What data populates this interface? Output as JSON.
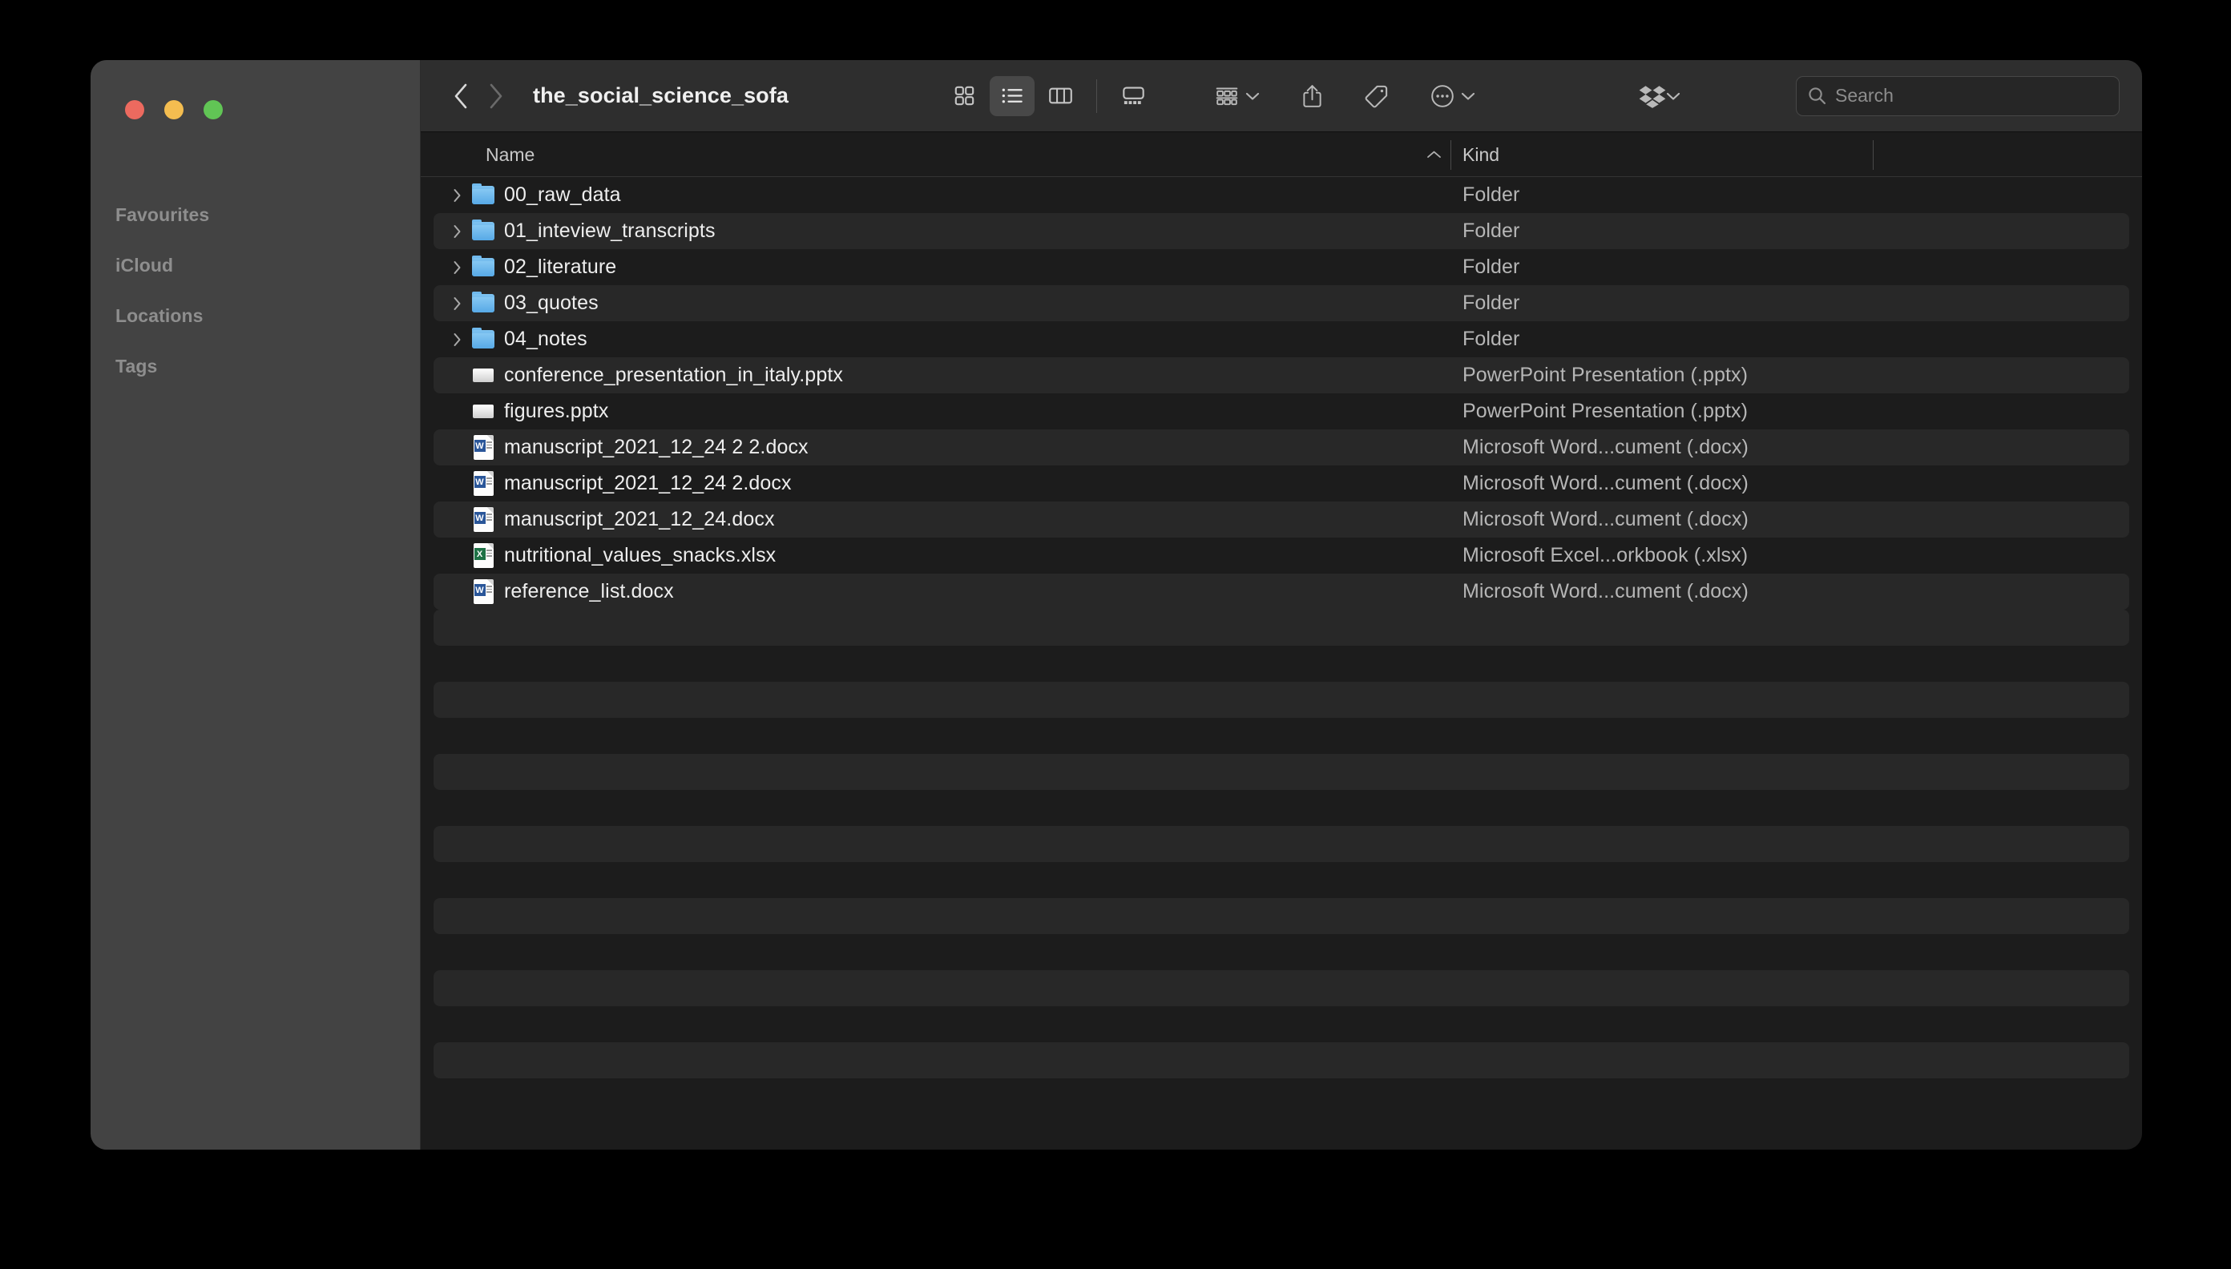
{
  "window": {
    "traffic_lights": [
      {
        "name": "close",
        "color": "#ec6a5f"
      },
      {
        "name": "minimize",
        "color": "#f4bd50"
      },
      {
        "name": "maximize",
        "color": "#61c555"
      }
    ]
  },
  "sidebar": {
    "sections": [
      {
        "label": "Favourites"
      },
      {
        "label": "iCloud"
      },
      {
        "label": "Locations"
      },
      {
        "label": "Tags"
      }
    ]
  },
  "toolbar": {
    "back_icon": "chevron-left-icon",
    "forward_icon": "chevron-right-icon",
    "title": "the_social_science_sofa",
    "view_modes": [
      {
        "name": "icon-view",
        "icon": "grid-icon",
        "active": false
      },
      {
        "name": "list-view",
        "icon": "list-icon",
        "active": true
      },
      {
        "name": "column-view",
        "icon": "columns-icon",
        "active": false
      },
      {
        "name": "gallery-view",
        "icon": "gallery-icon",
        "active": false
      }
    ],
    "actions": [
      {
        "name": "group-by",
        "icon": "group-icon",
        "has_chevron": true
      },
      {
        "name": "share",
        "icon": "share-icon",
        "has_chevron": false
      },
      {
        "name": "tag",
        "icon": "tag-icon",
        "has_chevron": false
      },
      {
        "name": "more-options",
        "icon": "ellipsis-circle-icon",
        "has_chevron": true
      },
      {
        "name": "dropbox",
        "icon": "dropbox-icon",
        "has_chevron": true
      }
    ]
  },
  "search": {
    "icon": "search-icon",
    "placeholder": "Search",
    "value": ""
  },
  "file_table": {
    "columns": [
      {
        "key": "name",
        "label": "Name",
        "sorted": true,
        "sort_direction": "ascending",
        "sort_icon": "chevron-up-icon"
      },
      {
        "key": "kind",
        "label": "Kind",
        "sorted": false
      }
    ],
    "rows": [
      {
        "name": "00_raw_data",
        "kind": "Folder",
        "icon": "folder-icon",
        "expandable": true,
        "striped": false
      },
      {
        "name": "01_inteview_transcripts",
        "kind": "Folder",
        "icon": "folder-icon",
        "expandable": true,
        "striped": true
      },
      {
        "name": "02_literature",
        "kind": "Folder",
        "icon": "folder-icon",
        "expandable": true,
        "striped": false
      },
      {
        "name": "03_quotes",
        "kind": "Folder",
        "icon": "folder-icon",
        "expandable": true,
        "striped": true
      },
      {
        "name": "04_notes",
        "kind": "Folder",
        "icon": "folder-icon",
        "expandable": true,
        "striped": false
      },
      {
        "name": "conference_presentation_in_italy.pptx",
        "kind": "PowerPoint Presentation (.pptx)",
        "icon": "powerpoint-icon",
        "expandable": false,
        "striped": true
      },
      {
        "name": "figures.pptx",
        "kind": "PowerPoint Presentation (.pptx)",
        "icon": "powerpoint-icon",
        "expandable": false,
        "striped": false
      },
      {
        "name": "manuscript_2021_12_24 2 2.docx",
        "kind": "Microsoft Word...cument (.docx)",
        "icon": "word-icon",
        "expandable": false,
        "striped": true
      },
      {
        "name": "manuscript_2021_12_24 2.docx",
        "kind": "Microsoft Word...cument (.docx)",
        "icon": "word-icon",
        "expandable": false,
        "striped": false
      },
      {
        "name": "manuscript_2021_12_24.docx",
        "kind": "Microsoft Word...cument (.docx)",
        "icon": "word-icon",
        "expandable": false,
        "striped": true
      },
      {
        "name": "nutritional_values_snacks.xlsx",
        "kind": "Microsoft Excel...orkbook (.xlsx)",
        "icon": "excel-icon",
        "expandable": false,
        "striped": false
      },
      {
        "name": "reference_list.docx",
        "kind": "Microsoft Word...cument (.docx)",
        "icon": "word-icon",
        "expandable": false,
        "striped": true
      }
    ],
    "empty_row_count": 14,
    "word_badge": "W",
    "excel_badge": "X"
  },
  "colors": {
    "window_sidebar": "#434343",
    "content_bg": "#1c1c1c",
    "toolbar_bg": "#2e2e2e",
    "row_stripe": "#282828",
    "folder_blue": "#57a9e6",
    "word_blue": "#2a5699",
    "excel_green": "#1e7145",
    "text_primary": "#eeeeee",
    "text_secondary": "#b6b6b6"
  }
}
